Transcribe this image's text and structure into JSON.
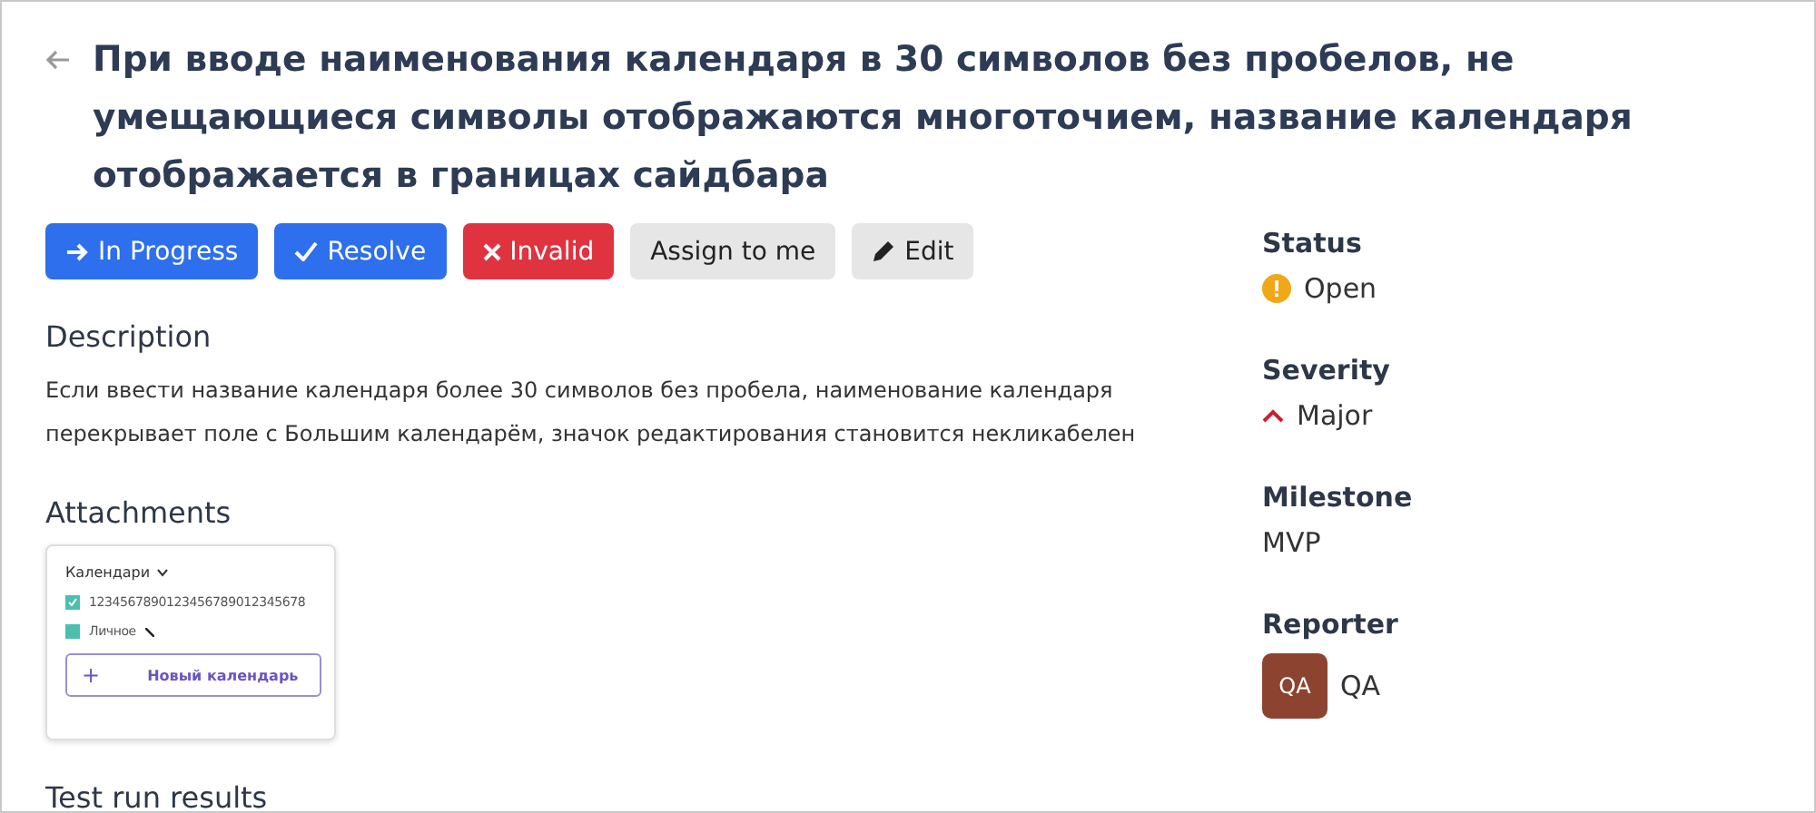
{
  "title": "При вводе наименования календаря в 30 символов без пробелов, не умещающиеся символы отображаются многоточием, название календаря отображается в границах сайдбара",
  "buttons": [
    {
      "label": "In Progress",
      "kind": "progress"
    },
    {
      "label": "Resolve",
      "kind": "resolve"
    },
    {
      "label": "Invalid",
      "kind": "invalid"
    },
    {
      "label": "Assign to me",
      "kind": "assign"
    },
    {
      "label": "Edit",
      "kind": "edit"
    }
  ],
  "description": {
    "heading": "Description",
    "text": "Если ввести название календаря более 30 символов без пробела, наименование календаря перекрывает поле с Большим календарём, значок редактирования становится некликабелен"
  },
  "attachments": {
    "heading": "Attachments",
    "thumbnail": {
      "header": "Календари",
      "calendars": [
        {
          "name": "1234567890123456789012345678",
          "checked": true
        },
        {
          "name": "Личное",
          "checked": false
        }
      ],
      "plus": "+",
      "new_button": "Новый календарь"
    }
  },
  "test_runs": {
    "heading": "Test run results"
  },
  "fields": [
    {
      "label": "Status",
      "value": "Open",
      "kind": "status"
    },
    {
      "label": "Severity",
      "value": "Major",
      "kind": "severity"
    },
    {
      "label": "Milestone",
      "value": "MVP",
      "kind": "plain"
    },
    {
      "label": "Reporter",
      "value": "QA",
      "initials": "QA",
      "kind": "avatar"
    }
  ]
}
